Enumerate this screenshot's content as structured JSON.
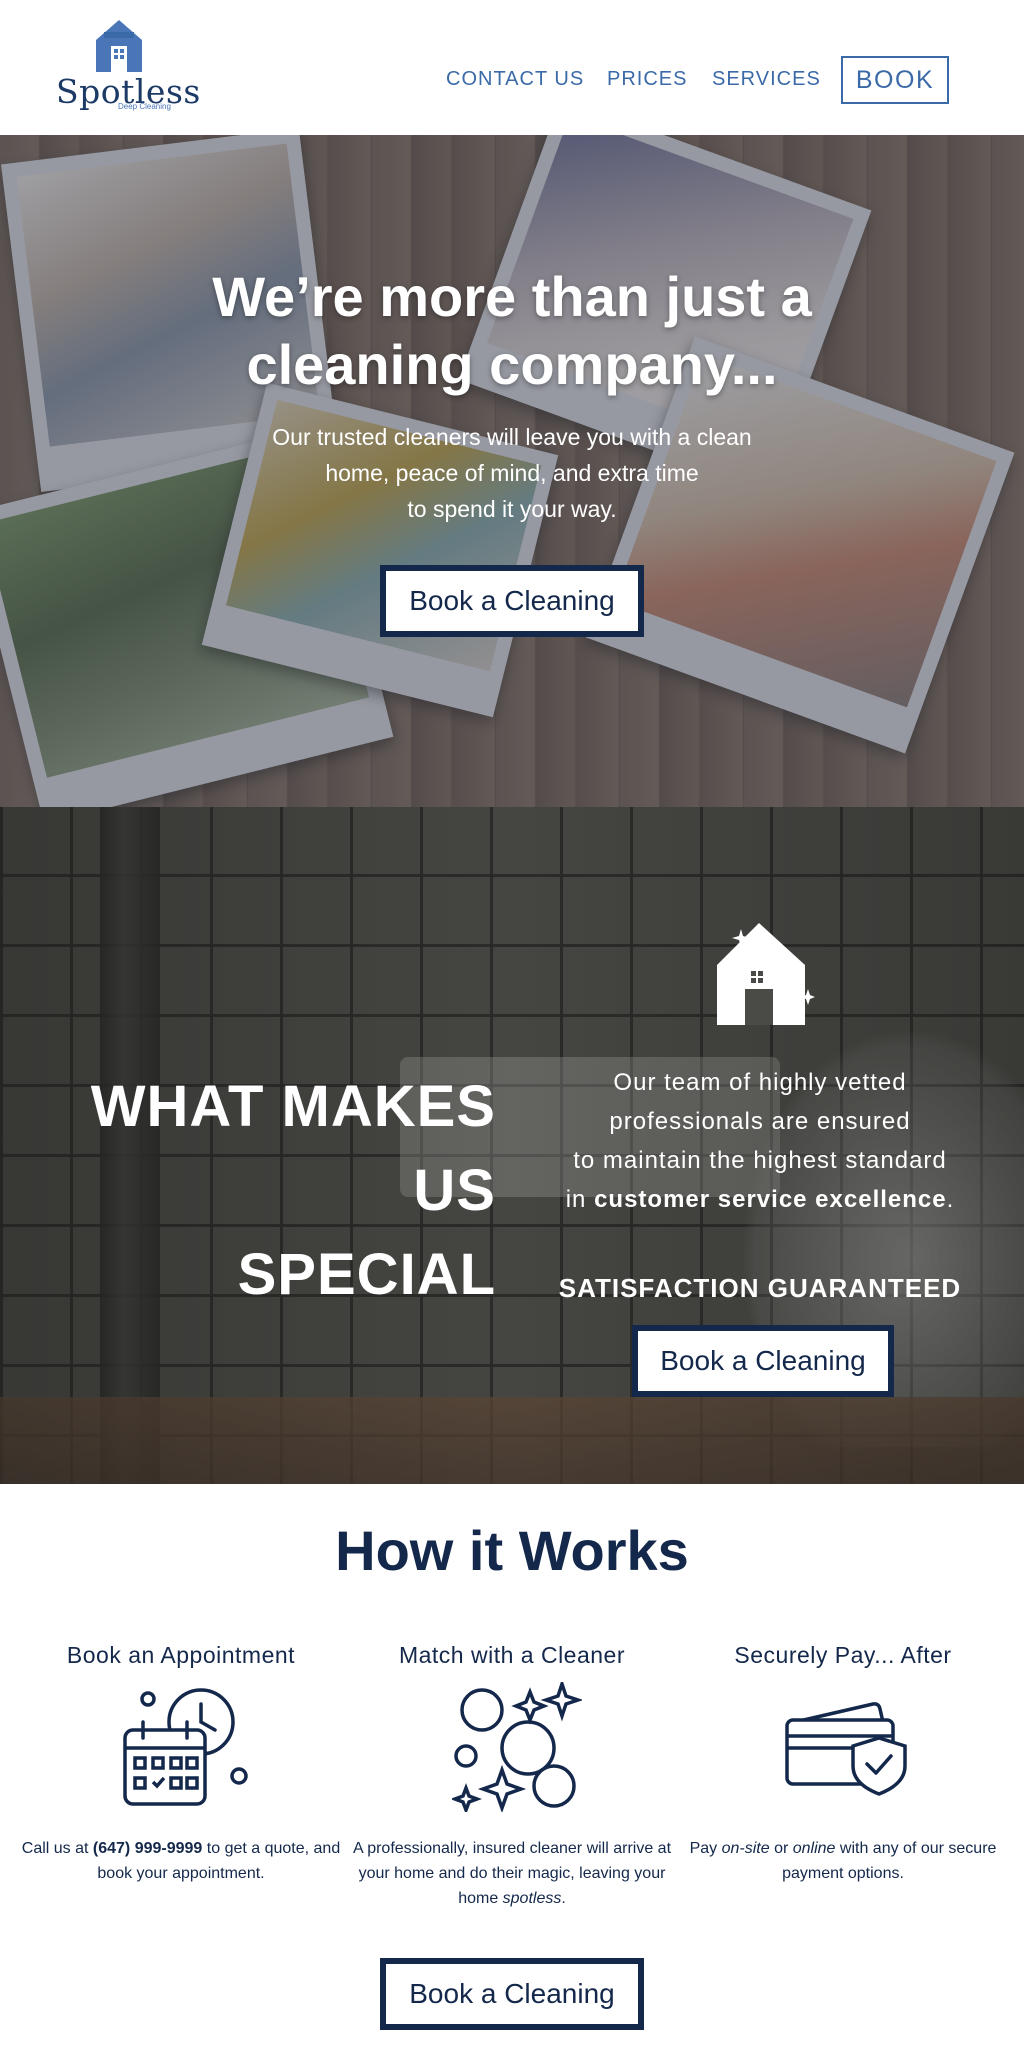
{
  "brand": {
    "name": "Spotless",
    "tagline": "Deep Cleaning",
    "primary_color": "#3b6aa8",
    "dark_color": "#14284b"
  },
  "nav": {
    "items": [
      {
        "label": "CONTACT US"
      },
      {
        "label": "PRICES"
      },
      {
        "label": "SERVICES"
      }
    ],
    "book_label": "BOOK"
  },
  "hero": {
    "title_line1": "We’re more than just a",
    "title_line2": "cleaning company...",
    "sub_line1": "Our trusted cleaners will leave you with a clean",
    "sub_line2": "home, peace of mind, and extra time",
    "sub_line3": "to spend it your way.",
    "cta": "Book a Cleaning"
  },
  "special": {
    "title_line1": "WHAT MAKES US",
    "title_line2": "SPECIAL",
    "text_line1": "Our team of highly vetted",
    "text_line2": "professionals are ensured",
    "text_line3": "to maintain the highest standard",
    "text_line4_pre": "in ",
    "text_line4_bold": "customer service excellence",
    "text_line4_post": ".",
    "satisfaction": "SATISFACTION GUARANTEED",
    "cta": "Book a Cleaning",
    "icon": "house-sparkle-icon"
  },
  "how": {
    "title": "How it Works",
    "steps": [
      {
        "title": "Book an Appointment",
        "icon": "calendar-clock-icon",
        "desc_pre": "Call us at ",
        "desc_bold": "(647) 999-9999",
        "desc_post": " to get a quote, and book your appointment."
      },
      {
        "title": "Match with a Cleaner",
        "icon": "bubbles-sparkle-icon",
        "desc_pre": "A professionally, insured cleaner will arrive at your home and do their magic, leaving your home ",
        "desc_italic": "spotless",
        "desc_post": "."
      },
      {
        "title": "Securely Pay... After",
        "icon": "credit-card-shield-icon",
        "desc_pre": "Pay ",
        "desc_italic1": "on-site",
        "desc_mid": " or ",
        "desc_italic2": "online",
        "desc_post": " with any of our secure payment options."
      }
    ],
    "cta": "Book a Cleaning"
  }
}
